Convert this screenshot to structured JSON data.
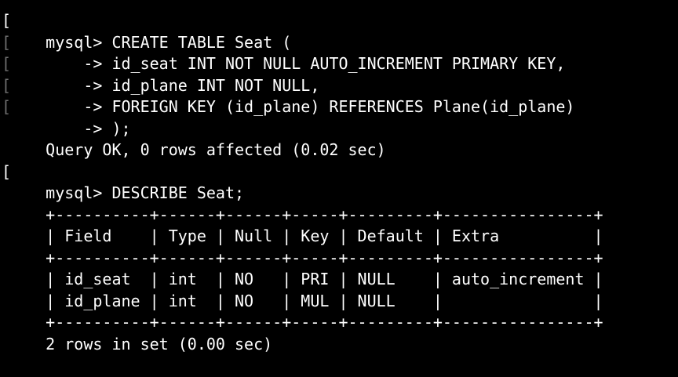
{
  "terminal": {
    "lines": [
      {
        "marker": "[",
        "marker_dim": false,
        "text": "mysql> CREATE TABLE Seat ("
      },
      {
        "marker": "[",
        "marker_dim": true,
        "text": "    -> id_seat INT NOT NULL AUTO_INCREMENT PRIMARY KEY,"
      },
      {
        "marker": "[",
        "marker_dim": true,
        "text": "    -> id_plane INT NOT NULL,"
      },
      {
        "marker": "[",
        "marker_dim": true,
        "text": "    -> FOREIGN KEY (id_plane) REFERENCES Plane(id_plane)"
      },
      {
        "marker": "[",
        "marker_dim": true,
        "text": "    -> );"
      },
      {
        "marker": "",
        "marker_dim": true,
        "text": "Query OK, 0 rows affected (0.02 sec)"
      },
      {
        "marker": "",
        "marker_dim": true,
        "text": ""
      },
      {
        "marker": "[",
        "marker_dim": false,
        "text": "mysql> DESCRIBE Seat;"
      },
      {
        "marker": "",
        "marker_dim": true,
        "text": "+----------+------+------+-----+---------+----------------+"
      },
      {
        "marker": "",
        "marker_dim": true,
        "text": "| Field    | Type | Null | Key | Default | Extra          |"
      },
      {
        "marker": "",
        "marker_dim": true,
        "text": "+----------+------+------+-----+---------+----------------+"
      },
      {
        "marker": "",
        "marker_dim": true,
        "text": "| id_seat  | int  | NO   | PRI | NULL    | auto_increment |"
      },
      {
        "marker": "",
        "marker_dim": true,
        "text": "| id_plane | int  | NO   | MUL | NULL    |                |"
      },
      {
        "marker": "",
        "marker_dim": true,
        "text": "+----------+------+------+-----+---------+----------------+"
      },
      {
        "marker": "",
        "marker_dim": true,
        "text": "2 rows in set (0.00 sec)"
      }
    ]
  },
  "colors": {
    "background": "#000000",
    "text": "#ffffff",
    "marker_dim": "#6e6e6e"
  }
}
